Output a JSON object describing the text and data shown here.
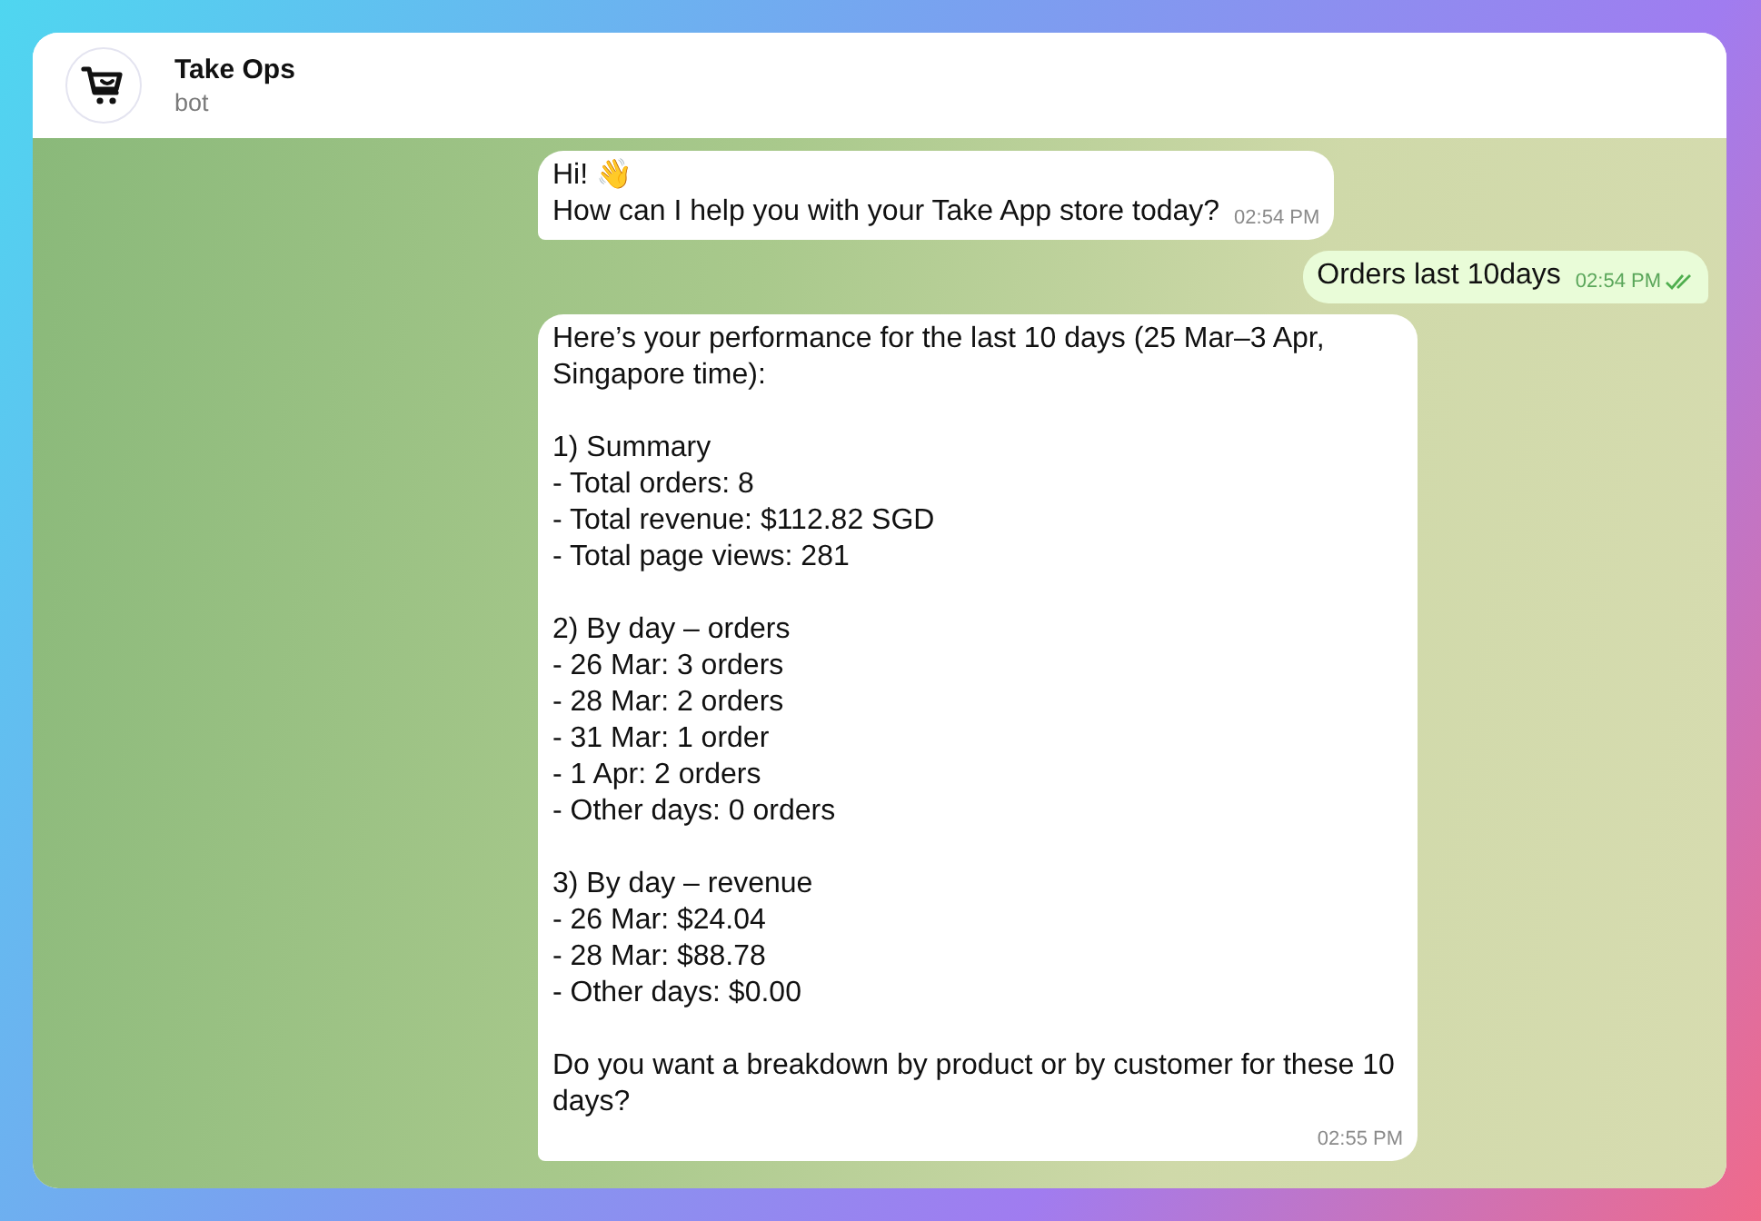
{
  "chat": {
    "title": "Take Ops",
    "subtitle": "bot"
  },
  "messages": [
    {
      "kind": "incoming",
      "text": "Hi! 👋\nHow can I help you with your Take App store today?",
      "time": "02:54 PM"
    },
    {
      "kind": "outgoing",
      "text": "Orders last 10days",
      "time": "02:54 PM",
      "read": true
    },
    {
      "kind": "incoming",
      "text": "Here’s your performance for the last 10 days (25 Mar–3 Apr, Singapore time):\n\n1) Summary\n- Total orders: 8\n- Total revenue: $112.82 SGD\n- Total page views: 281\n\n2) By day – orders\n- 26 Mar: 3 orders\n- 28 Mar: 2 orders\n- 31 Mar: 1 order\n- 1 Apr: 2 orders\n- Other days: 0 orders\n\n3) By day – revenue\n- 26 Mar: $24.04\n- 28 Mar: $88.78\n- Other days: $0.00\n\nDo you want a breakdown by product or by customer for these 10 days?",
      "time": "02:55 PM"
    }
  ]
}
